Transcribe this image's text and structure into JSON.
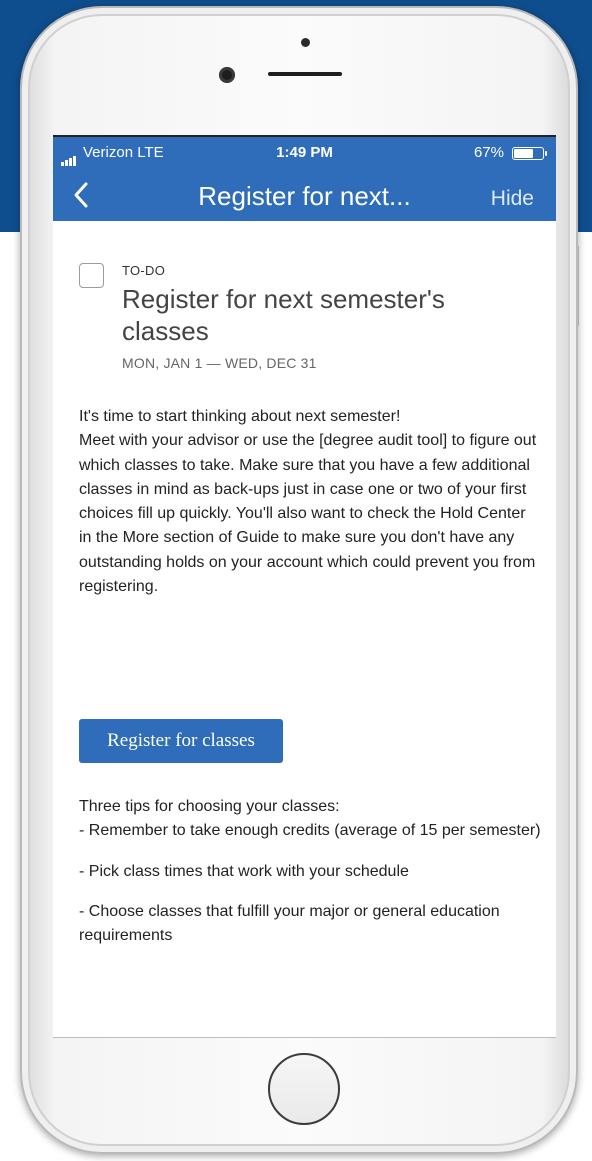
{
  "status_bar": {
    "carrier": "Verizon  LTE",
    "time": "1:49 PM",
    "battery": "67%",
    "battery_level": 0.67
  },
  "nav": {
    "back_icon": "chevron-left-icon",
    "title": "Register for next...",
    "hide_label": "Hide"
  },
  "task": {
    "type_label": "TO-DO",
    "title": "Register for next semester's classes",
    "dates": "MON, JAN 1 — WED, DEC 31",
    "checked": false,
    "description": "It's time to start thinking about next semester!\nMeet with your advisor or use the [degree audit tool] to figure out which classes to take. Make sure that you have a few additional classes in mind as back-ups just in case one or two of your first choices fill up quickly. You'll also want to check the Hold Center in the More section of Guide to make sure you don't have any outstanding holds on your account which could prevent you from registering.",
    "button_label": "Register for classes"
  },
  "tips": {
    "intro": "Three tips for choosing your classes:",
    "tip1": "- Remember to take enough credits (average of 15 per semester)",
    "tip2": "- Pick class times that work with your schedule",
    "tip3": "- Choose classes that fulfill your major or general education requirements"
  },
  "colors": {
    "app_bar": "#2f6dba",
    "button": "#2f6dba",
    "backdrop": "#0f4e8e"
  }
}
